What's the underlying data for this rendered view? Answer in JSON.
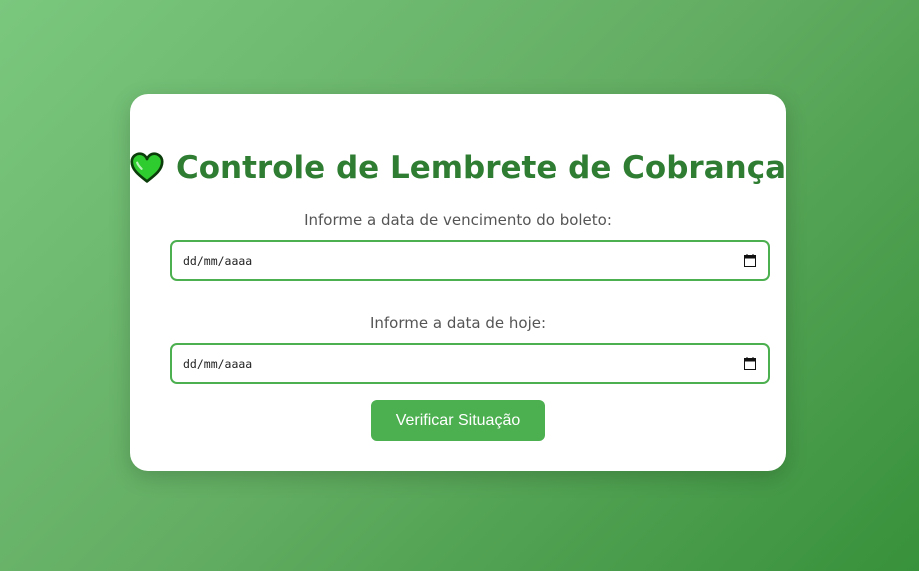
{
  "card": {
    "title": "Controle de Lembrete de Cobrança",
    "title_icon": "green-heart-icon",
    "due_date_label": "Informe a data de vencimento do boleto:",
    "due_date_placeholder": "dd/mm/aaaa",
    "today_label": "Informe a data de hoje:",
    "today_placeholder": "dd/mm/aaaa",
    "verify_button": "Verificar Situação"
  },
  "colors": {
    "accent": "#4caf50",
    "title": "#2e7d32",
    "label": "#555555"
  }
}
